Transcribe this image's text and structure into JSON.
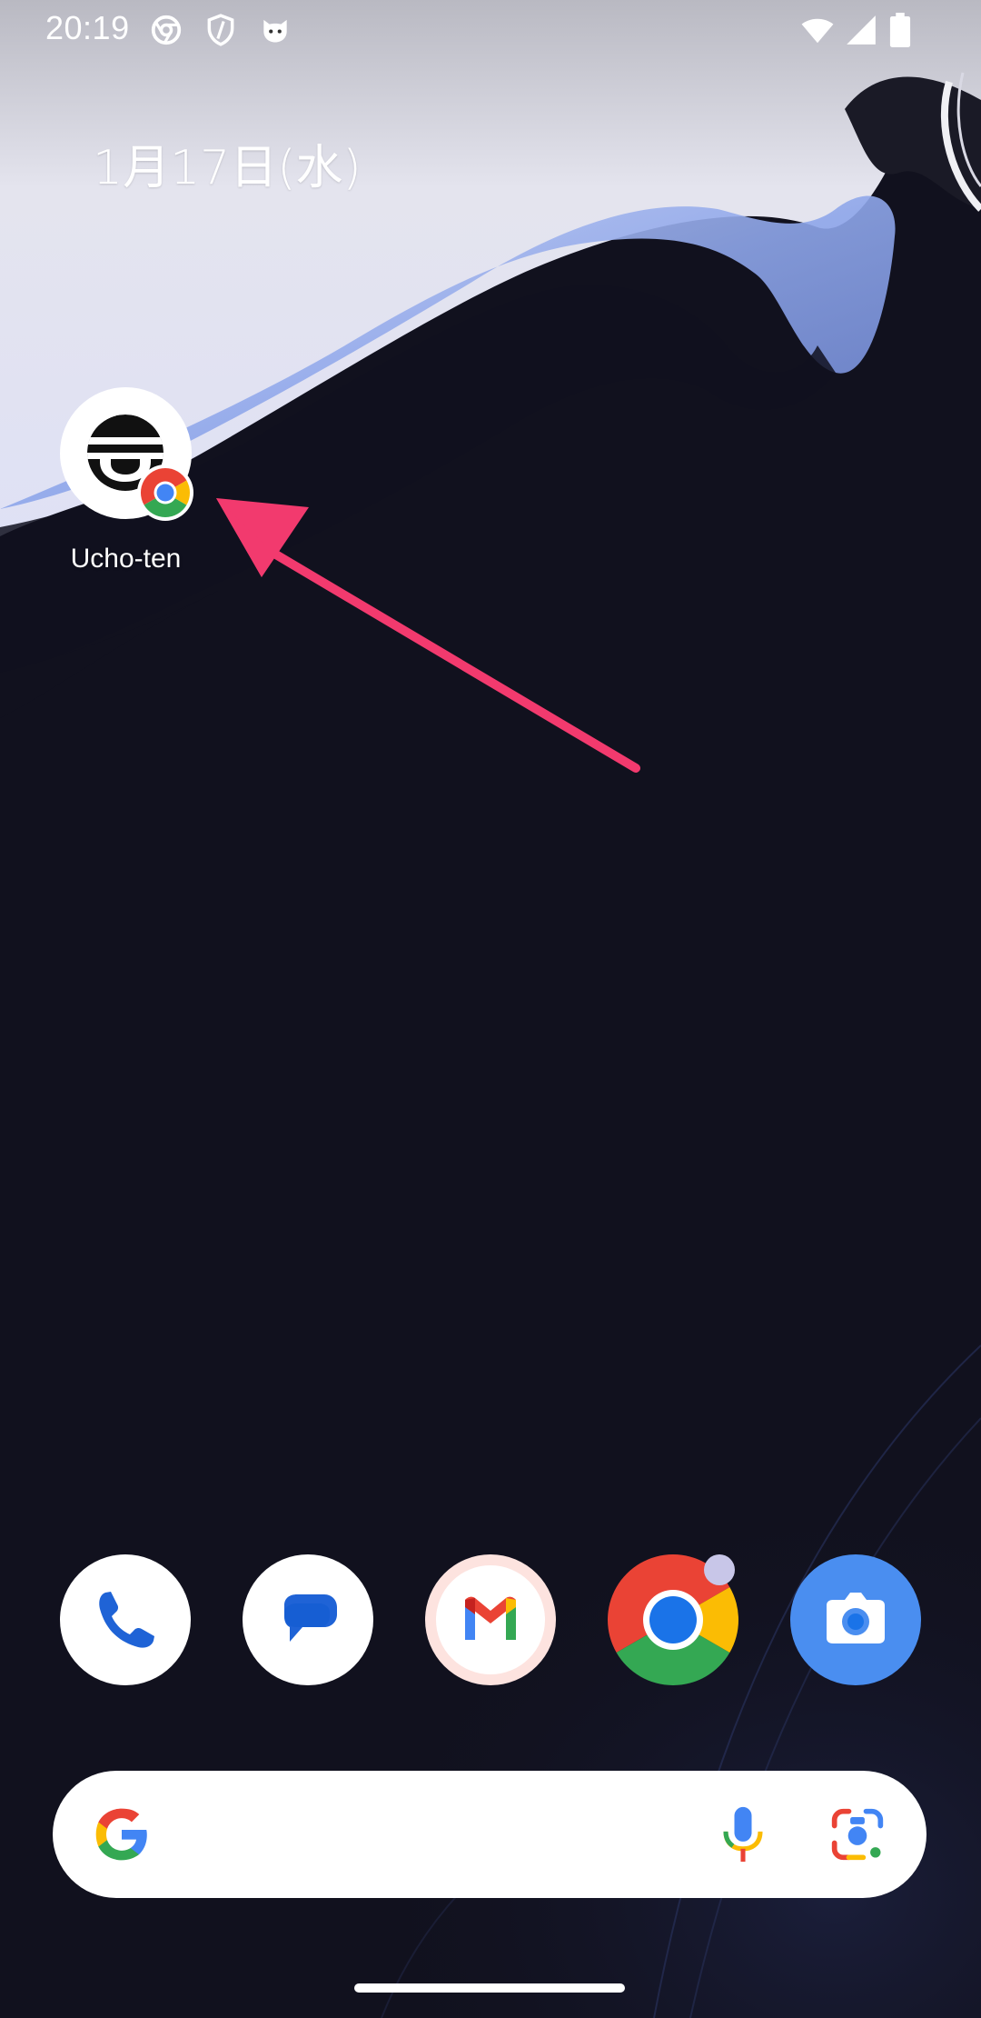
{
  "status_bar": {
    "time": "20:19",
    "left_icons": [
      "chrome-icon",
      "shield-icon",
      "cat-icon"
    ],
    "right_icons": [
      "wifi-icon",
      "signal-icon",
      "battery-icon"
    ]
  },
  "home": {
    "date": "1月17日(水)",
    "shortcut": {
      "label": "Ucho-ten",
      "badge": "chrome-badge-icon"
    },
    "annotation": {
      "color": "#f23a6e",
      "icon": "pointer-arrow-icon"
    }
  },
  "dock": {
    "apps": [
      {
        "name": "phone",
        "icon": "phone-icon"
      },
      {
        "name": "messages",
        "icon": "messages-icon"
      },
      {
        "name": "gmail",
        "icon": "gmail-icon"
      },
      {
        "name": "chrome",
        "icon": "chrome-icon",
        "notification_dot": true
      },
      {
        "name": "camera",
        "icon": "camera-icon"
      }
    ]
  },
  "search": {
    "icons": [
      "google-g-icon",
      "microphone-icon",
      "google-lens-icon"
    ]
  },
  "colors": {
    "google_blue": "#4285f4",
    "google_red": "#ea4335",
    "google_yellow": "#fbbc04",
    "google_green": "#34a853",
    "arrow": "#f23a6e",
    "wallpaper_dark": "#11111e",
    "wallpaper_light": "#a3b6ec"
  }
}
